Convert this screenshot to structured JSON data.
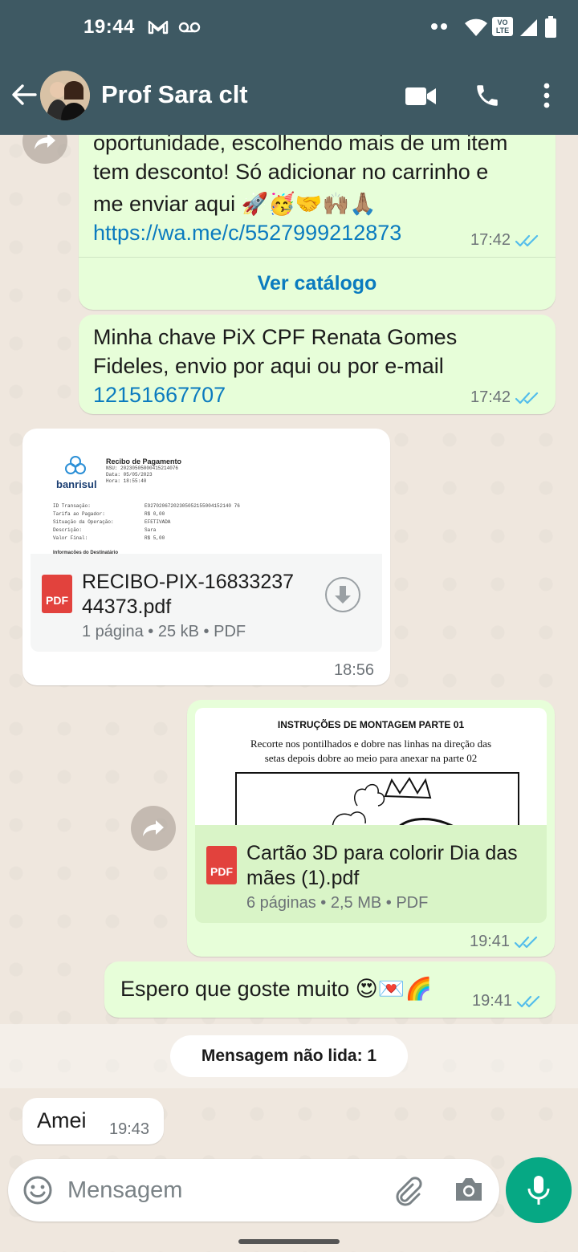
{
  "status_bar": {
    "time": "19:44"
  },
  "header": {
    "contact_name": "Prof Sara clt"
  },
  "messages": {
    "m1": {
      "text_line1": "oportunidade, escolhendo mais de um item",
      "text_line2": "tem desconto! Só adicionar no carrinho e",
      "text_line3": "me enviar aqui 🚀🥳🤝🙌🏽🙏🏽",
      "link": "https://wa.me/c/5527999212873",
      "time": "17:42",
      "action": "Ver catálogo"
    },
    "m2": {
      "text_line1": "Minha chave PiX CPF Renata Gomes",
      "text_line2": "Fideles, envio por aqui ou por e-mail",
      "number": "12151667707",
      "time": "17:42"
    },
    "m3": {
      "preview": {
        "bank": "banrisul",
        "heading": "Recibo de Pagamento",
        "rows": [
          "NSU:    20230505000415214076",
          "Data:   05/05/2023",
          "Hora:   18:55:40"
        ],
        "fields": [
          [
            "ID Transação:",
            "E92702067202305052155004152140 76"
          ],
          [
            "Tarifa ao Pagador:",
            "R$ 0,00"
          ],
          [
            "Situação da Operação:",
            "EFETIVADA"
          ],
          [
            "Descrição:",
            "Sara"
          ],
          [
            "Valor Final:",
            "R$ 5,00"
          ]
        ],
        "section": "Informações do Destinatário"
      },
      "file_name_line1": "RECIBO-PIX-16833237",
      "file_name_line2": "44373.pdf",
      "file_info": "1 página • 25 kB • PDF",
      "time": "18:56"
    },
    "m4": {
      "preview_title": "INSTRUÇÕES DE MONTAGEM PARTE 01",
      "preview_line1": "Recorte nos pontilhados e dobre nas linhas na direção das",
      "preview_line2": "setas  depois dobre ao meio para  anexar na parte 02",
      "file_name_line1": "Cartão 3D para colorir Dia das",
      "file_name_line2": "mães  (1).pdf",
      "file_info": "6 páginas • 2,5 MB • PDF",
      "time": "19:41"
    },
    "m5": {
      "text": "Espero que goste muito 😍💌🌈",
      "time": "19:41"
    },
    "unread_label": "Mensagem não lida: 1",
    "m6": {
      "text": "Amei",
      "time": "19:43"
    }
  },
  "composer": {
    "placeholder": "Mensagem"
  },
  "colors": {
    "header": "#3e5963",
    "outgoing": "#e7fed9",
    "incoming": "#ffffff",
    "accent": "#06a884",
    "link": "#0b7bbf"
  }
}
